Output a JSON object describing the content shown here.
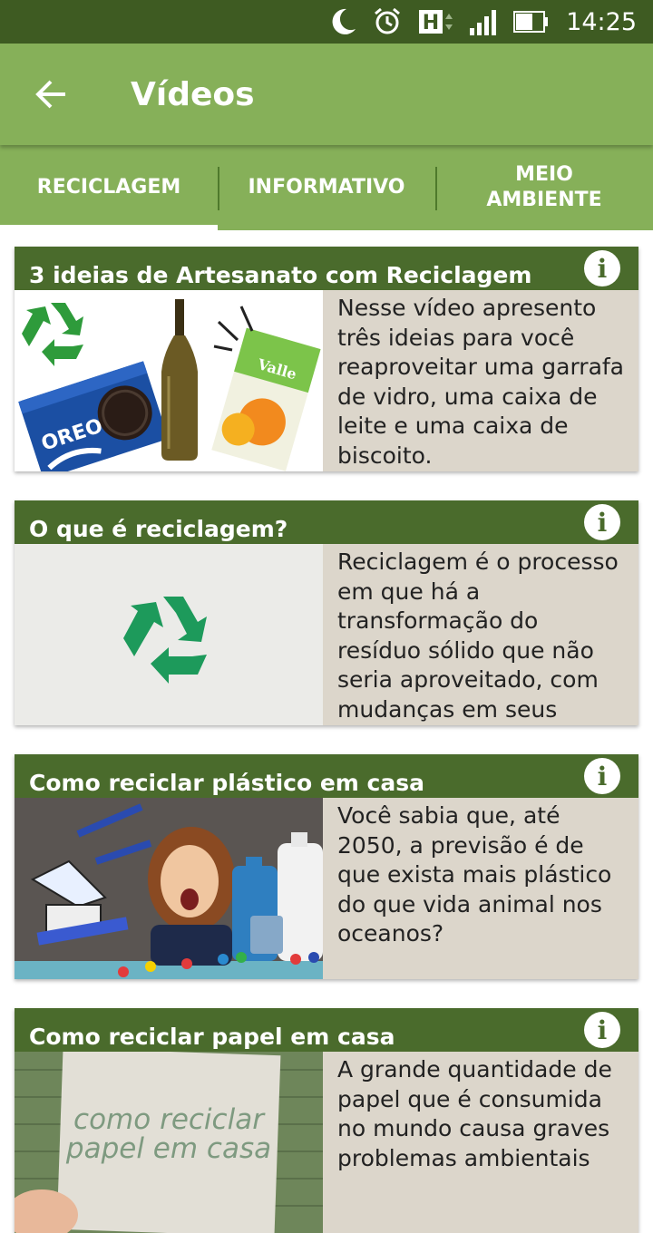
{
  "status_bar": {
    "time": "14:25",
    "icons": [
      "moon-icon",
      "alarm-icon",
      "h-network-icon",
      "signal-icon",
      "battery-icon"
    ]
  },
  "app_bar": {
    "title": "Vídeos",
    "back_icon": "arrow-left-icon"
  },
  "tabs": [
    {
      "label": "RECICLAGEM",
      "active": true
    },
    {
      "label": "INFORMATIVO",
      "active": false
    },
    {
      "label": "MEIO\nAMBIENTE",
      "active": false
    }
  ],
  "colors": {
    "status_bar": "#3e5b22",
    "primary": "#86b059",
    "card_header": "#4a6b2c",
    "card_body": "#dcd6cb"
  },
  "videos": [
    {
      "title": "3 ideias de Artesanato com Reciclagem",
      "description": "Nesse vídeo apresento três ideias para você reaproveitar uma garrafa de vidro, uma caixa de leite e uma caixa de biscoito.",
      "thumbnail_text": {
        "oreo": "OREO",
        "valle": "Valle"
      }
    },
    {
      "title": "O que é reciclagem?",
      "description": "Reciclagem é o processo em que há a transformação do resíduo sólido que não seria aproveitado, com mudanças em seus"
    },
    {
      "title": "Como reciclar plástico em casa",
      "description": "Você sabia que, até 2050, a previsão é de que exista mais plástico do que vida animal nos oceanos?"
    },
    {
      "title": "Como reciclar papel em casa",
      "description": "A grande quantidade de papel que é consumida no mundo causa graves problemas ambientais",
      "thumbnail_text": {
        "line1": "como reciclar",
        "line2": "papel em casa"
      }
    }
  ]
}
